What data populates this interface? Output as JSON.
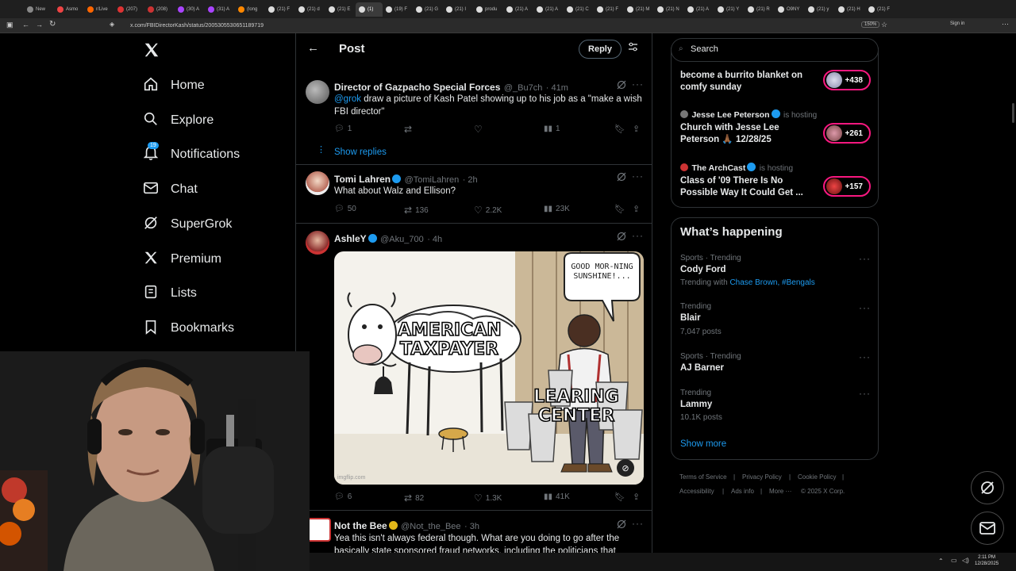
{
  "browser": {
    "tabs": [
      "New",
      "Asmo",
      "r/Live",
      "(207)",
      "(208)",
      "(30) A",
      "(31) A",
      "(long",
      "(21) F",
      "(21) d",
      "(21) E",
      "(1)",
      "(19) F",
      "(21) G",
      "(21) I",
      "produ",
      "(21) A",
      "(21) A",
      "(21) C",
      "(21) F",
      "(21) M",
      "(21) N",
      "(21) A",
      "(21) Y",
      "(21) R",
      "O9NY",
      "(21) y",
      "(21) H",
      "(21) F"
    ],
    "url": "x.com/FBIDirectorKash/status/2005305530651189719",
    "zoom": "150%",
    "sign_in": "Sign in"
  },
  "nav": {
    "logo": "X",
    "items": [
      {
        "label": "Home",
        "icon": "home-icon"
      },
      {
        "label": "Explore",
        "icon": "search-icon"
      },
      {
        "label": "Notifications",
        "icon": "bell-icon",
        "badge": "19"
      },
      {
        "label": "Chat",
        "icon": "mail-icon"
      },
      {
        "label": "SuperGrok",
        "icon": "grok-icon"
      },
      {
        "label": "Premium",
        "icon": "x-icon"
      },
      {
        "label": "Lists",
        "icon": "list-icon"
      },
      {
        "label": "Bookmarks",
        "icon": "bookmark-icon"
      }
    ]
  },
  "header": {
    "title": "Post",
    "reply_button": "Reply"
  },
  "tweets": [
    {
      "name": "Director of Gazpacho Special Forces",
      "handle": "@_Bu7ch",
      "time": "· 41m",
      "mention": "@grok",
      "text": "draw a picture of Kash Patel showing up to his job as a \"make a wish FBI director\"",
      "replies": "1",
      "reposts": "",
      "likes": "",
      "views": "1",
      "show_replies": "Show replies"
    },
    {
      "name": "Tomi Lahren",
      "handle": "@TomiLahren",
      "time": "· 2h",
      "text": "What about Walz and Ellison?",
      "replies": "50",
      "reposts": "136",
      "likes": "2.2K",
      "views": "23K"
    },
    {
      "name": "AshleY",
      "handle": "@Aku_700",
      "time": "· 4h",
      "image": {
        "bubble": "GOOD MOR-NING SUNSHINE!...",
        "label1": "AMERICAN TAXPAYER",
        "label2": "LEARING CENTER",
        "watermark": "imgflip.com"
      },
      "replies": "6",
      "reposts": "82",
      "likes": "1.3K",
      "views": "41K"
    },
    {
      "name": "Not the Bee",
      "handle": "@Not_the_Bee",
      "time": "· 3h",
      "text": "Yea this isn't always federal though. What are you doing to go after the basically state sponsored fraud networks, including the politicians that"
    }
  ],
  "right": {
    "search_placeholder": "Search",
    "spaces": [
      {
        "title": "become a burrito blanket on comfy sunday",
        "count": "+438"
      },
      {
        "host": "Jesse Lee Peterson",
        "hosting": "is hosting",
        "title": "Church with Jesse Lee Peterson",
        "emoji": "🙏🏾",
        "date": "12/28/25",
        "count": "+261"
      },
      {
        "host": "The ArchCast",
        "hosting": "is hosting",
        "title": "Class of '09 There Is No Possible Way It Could Get ...",
        "count": "+157"
      }
    ],
    "happening_title": "What’s happening",
    "trends": [
      {
        "context": "Sports · Trending",
        "name": "Cody Ford",
        "extra_prefix": "Trending with",
        "extra_links": "Chase Brown, #Bengals"
      },
      {
        "context": "Trending",
        "name": "Blair",
        "posts": "7,047 posts"
      },
      {
        "context": "Sports · Trending",
        "name": "AJ Barner"
      },
      {
        "context": "Trending",
        "name": "Lammy",
        "posts": "10.1K posts"
      }
    ],
    "show_more": "Show more",
    "footer": [
      "Terms of Service",
      "Privacy Policy",
      "Cookie Policy",
      "Accessibility",
      "Ads info",
      "More ···",
      "© 2025 X Corp."
    ]
  },
  "taskbar": {
    "time": "2:11 PM",
    "date": "12/28/2025"
  },
  "colors": {
    "accent": "#1d9bf0",
    "space_ring": "#f91880",
    "bg": "#000000",
    "border": "#2f3336"
  }
}
